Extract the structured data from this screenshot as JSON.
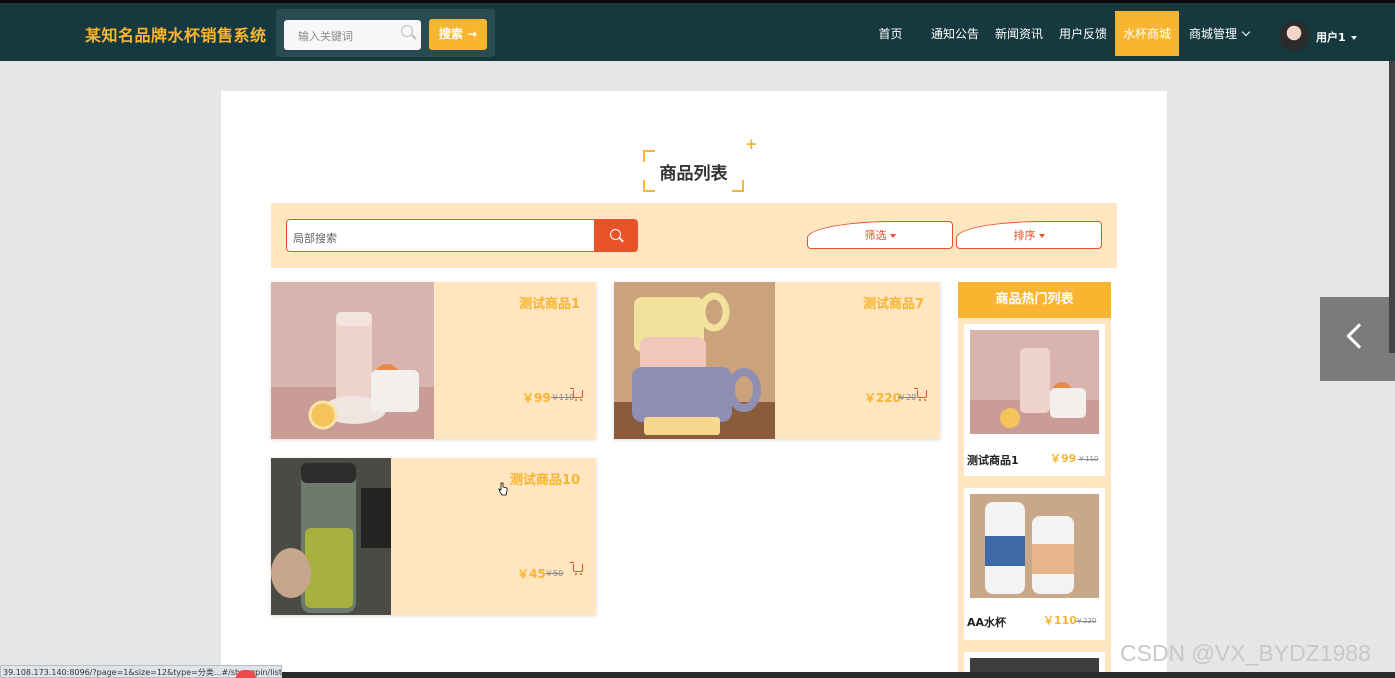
{
  "header": {
    "brand": "某知名品牌水杯销售系统",
    "search_placeholder": "输入关键词",
    "search_button": "搜索 →",
    "nav": [
      "首页",
      "通知公告",
      "新闻资讯",
      "用户反馈",
      "水杯商城",
      "商城管理"
    ],
    "active_nav": "水杯商城",
    "username": "用户1"
  },
  "page": {
    "title": "商品列表",
    "local_search_placeholder": "局部搜索",
    "filter_label": "筛选",
    "sort_label": "排序"
  },
  "products": [
    {
      "name": "测试商品1",
      "price": "￥99",
      "old_price": "￥110"
    },
    {
      "name": "测试商品7",
      "price": "￥220",
      "old_price": "￥20"
    },
    {
      "name": "测试商品10",
      "price": "￥45",
      "old_price": "￥50"
    }
  ],
  "hot": {
    "title": "商品热门列表",
    "items": [
      {
        "name": "测试商品1",
        "price": "￥99",
        "old_price": "￥110"
      },
      {
        "name": "AA水杯",
        "price": "￥110",
        "old_price": "￥220"
      }
    ]
  },
  "statusbar": {
    "url": "39.108.173.140:8096/?page=1&size=12&type=分类...#/shangpin/list"
  },
  "watermark": "CSDN @VX_BYDZ1988",
  "colors": {
    "header_bg": "#15393f",
    "accent": "#f8b52f",
    "panel_tint": "#ffe5c0",
    "search_red": "#e8532a"
  }
}
